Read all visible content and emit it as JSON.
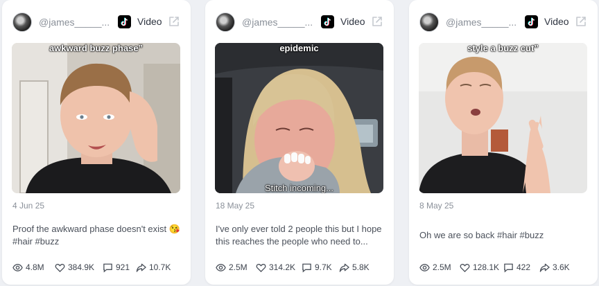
{
  "colors": {
    "background": "#eef0f4",
    "card": "#ffffff",
    "muted_text": "#8a9099",
    "body_text": "#4a505a"
  },
  "cards": [
    {
      "username": "@james_____...",
      "platform_label": "Video",
      "thumbnail_top_caption": "awkward buzz phase”",
      "thumbnail_bottom_caption": "",
      "date": "4 Jun 25",
      "description": "Proof the awkward phase doesn't exist 😘 #hair #buzz",
      "stats": {
        "views": "4.8M",
        "likes": "384.9K",
        "comments": "921",
        "shares": "10.7K"
      }
    },
    {
      "username": "@james_____...",
      "platform_label": "Video",
      "thumbnail_top_caption": "epidemic",
      "thumbnail_bottom_caption": "Stitch incoming...",
      "date": "18 May 25",
      "description": "I've only ever told 2 people this but I hope this reaches the people who need to...",
      "stats": {
        "views": "2.5M",
        "likes": "314.2K",
        "comments": "9.7K",
        "shares": "5.8K"
      }
    },
    {
      "username": "@james_____...",
      "platform_label": "Video",
      "thumbnail_top_caption": "style a buzz cut”",
      "thumbnail_bottom_caption": "",
      "date": "8 May 25",
      "description": "Oh we are so back #hair #buzz",
      "stats": {
        "views": "2.5M",
        "likes": "128.1K",
        "comments": "422",
        "shares": "3.6K"
      }
    }
  ]
}
